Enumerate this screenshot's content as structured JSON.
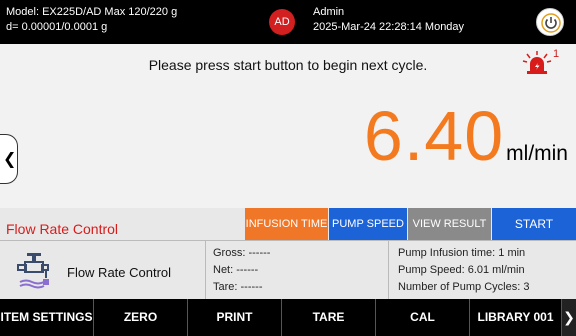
{
  "header": {
    "model_line": "Model: EX225D/AD   Max 120/220 g",
    "division_line": "d= 0.00001/0.0001 g",
    "avatar_initials": "AD",
    "user_name": "Admin",
    "datetime": "2025-Mar-24 22:28:14 Monday",
    "power_icon": "power-icon"
  },
  "main": {
    "message": "Please press start button to begin next cycle.",
    "alarm_icon": "alarm-icon",
    "alarm_count": "1",
    "side_tab_glyph": "❮",
    "reading_value": "6.40",
    "reading_unit": "ml/min",
    "mode_label": "Flow Rate Control",
    "reading_color": "#f47a1f"
  },
  "actions": {
    "infusion_time": "INFUSION TIME",
    "pump_speed": "PUMP SPEED",
    "view_result": "VIEW RESULT",
    "start": "START"
  },
  "info": {
    "mode_label": "Flow Rate Control",
    "mode_icon": "valve-icon",
    "gross": "Gross: ------",
    "net": "Net: ------",
    "tare": "Tare: ------",
    "infusion_time": "Pump Infusion time: 1 min",
    "pump_speed": "Pump Speed: 6.01 ml/min",
    "pump_cycles": "Number of Pump Cycles: 3"
  },
  "bottombar": {
    "item_settings": "ITEM SETTINGS",
    "zero": "ZERO",
    "print": "PRINT",
    "tare": "TARE",
    "cal": "CAL",
    "library": "LIBRARY 001",
    "more_glyph": "❯"
  }
}
